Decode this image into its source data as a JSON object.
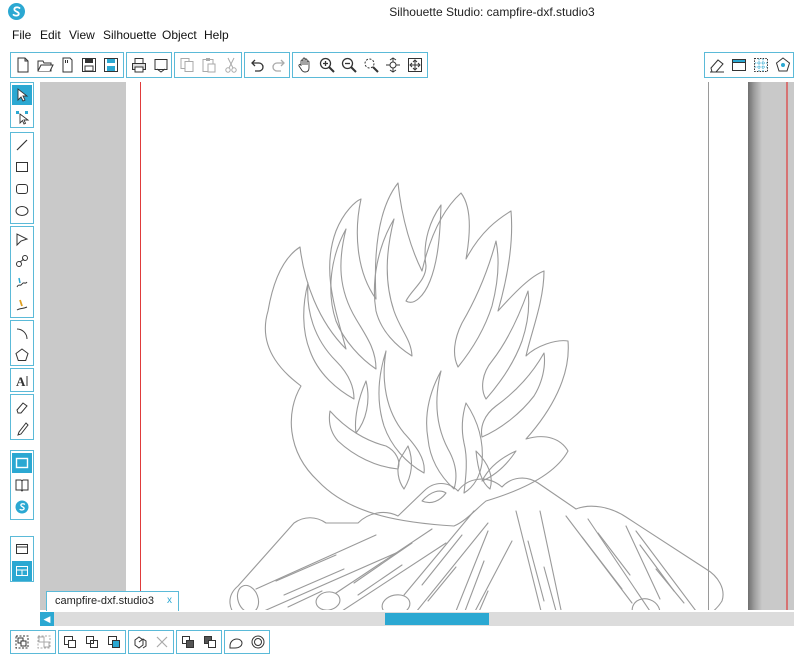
{
  "window": {
    "title": "Silhouette Studio: campfire-dxf.studio3"
  },
  "menu": {
    "items": [
      "File",
      "Edit",
      "View",
      "Silhouette",
      "Object",
      "Help"
    ]
  },
  "toolbar": {
    "file_icons": [
      "new-page-icon",
      "open-icon",
      "sd-card-icon",
      "save-icon",
      "save-to-library-icon"
    ],
    "print_icons": [
      "print-icon",
      "print-cut-icon"
    ],
    "clipboard_icons": [
      "copy-icon",
      "paste-icon",
      "cut-icon"
    ],
    "history_icons": [
      "undo-icon",
      "redo-icon"
    ],
    "view_icons": [
      "pan-hand-icon",
      "zoom-in-icon",
      "zoom-out-icon",
      "zoom-select-icon",
      "drag-zoom-icon",
      "fit-to-page-icon"
    ],
    "right_icons": [
      "eraser-panel-icon",
      "page-setup-icon",
      "grid-icon",
      "pattern-icon"
    ]
  },
  "document": {
    "tab_label": "campfire-dxf.studio3",
    "close_glyph": "x"
  },
  "scrollbar": {
    "left_arrow": "◀"
  },
  "colors": {
    "accent": "#2ba8d2",
    "margin_line": "#e03b3b",
    "artwork_stroke": "#9a9a9a"
  }
}
